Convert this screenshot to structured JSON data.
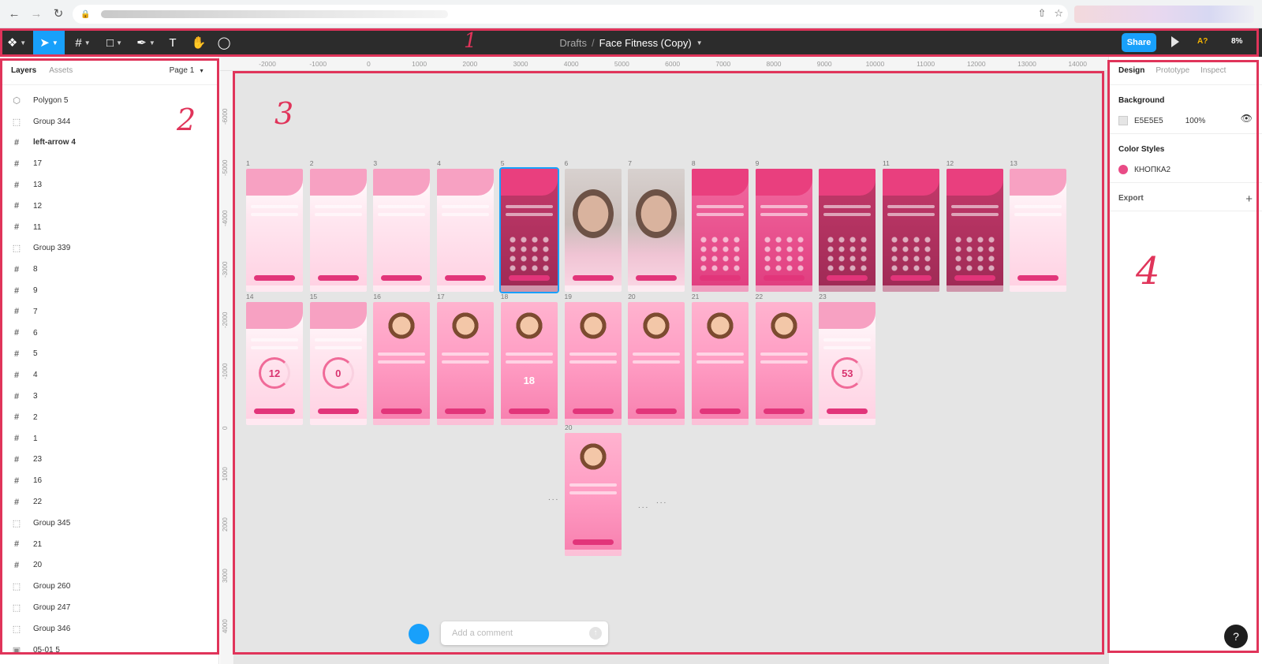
{
  "browser": {
    "back_icon": "arrow-left-icon",
    "forward_icon": "arrow-right-icon",
    "reload_icon": "reload-icon",
    "lock_icon": "lock-icon"
  },
  "toolbar": {
    "breadcrumb_root": "Drafts",
    "breadcrumb_sep": "/",
    "file_name": "Face Fitness (Copy)",
    "share_label": "Share",
    "annotation_label": "A?",
    "zoom_label": "8%"
  },
  "left_panel": {
    "tab_layers": "Layers",
    "tab_assets": "Assets",
    "page_selector": "Page 1",
    "layers": [
      {
        "name": "Polygon 5",
        "icon": "polygon-icon",
        "kind": "shape"
      },
      {
        "name": "Group 344",
        "icon": "group-icon",
        "kind": "group"
      },
      {
        "name": "left-arrow 4",
        "icon": "frame-icon",
        "kind": "frame-bold"
      },
      {
        "name": "17",
        "icon": "frame-icon",
        "kind": "frame"
      },
      {
        "name": "13",
        "icon": "frame-icon",
        "kind": "frame"
      },
      {
        "name": "12",
        "icon": "frame-icon",
        "kind": "frame"
      },
      {
        "name": "11",
        "icon": "frame-icon",
        "kind": "frame"
      },
      {
        "name": "Group 339",
        "icon": "group-icon",
        "kind": "group"
      },
      {
        "name": "8",
        "icon": "frame-icon",
        "kind": "frame"
      },
      {
        "name": "9",
        "icon": "frame-icon",
        "kind": "frame"
      },
      {
        "name": "7",
        "icon": "frame-icon",
        "kind": "frame"
      },
      {
        "name": "6",
        "icon": "frame-icon",
        "kind": "frame"
      },
      {
        "name": "5",
        "icon": "frame-icon",
        "kind": "frame"
      },
      {
        "name": "4",
        "icon": "frame-icon",
        "kind": "frame"
      },
      {
        "name": "3",
        "icon": "frame-icon",
        "kind": "frame"
      },
      {
        "name": "2",
        "icon": "frame-icon",
        "kind": "frame"
      },
      {
        "name": "1",
        "icon": "frame-icon",
        "kind": "frame"
      },
      {
        "name": "23",
        "icon": "frame-icon",
        "kind": "frame"
      },
      {
        "name": "16",
        "icon": "frame-icon",
        "kind": "frame"
      },
      {
        "name": "22",
        "icon": "frame-icon",
        "kind": "frame"
      },
      {
        "name": "Group 345",
        "icon": "group-icon",
        "kind": "group"
      },
      {
        "name": "21",
        "icon": "frame-icon",
        "kind": "frame"
      },
      {
        "name": "20",
        "icon": "frame-icon",
        "kind": "frame"
      },
      {
        "name": "Group 260",
        "icon": "group-icon",
        "kind": "group"
      },
      {
        "name": "Group 247",
        "icon": "group-icon",
        "kind": "group"
      },
      {
        "name": "Group 346",
        "icon": "group-icon",
        "kind": "group"
      },
      {
        "name": "05-01 5",
        "icon": "image-icon",
        "kind": "image"
      }
    ]
  },
  "ruler": {
    "top_ticks": [
      "-2000",
      "-1000",
      "0",
      "1000",
      "2000",
      "3000",
      "4000",
      "5000",
      "6000",
      "7000",
      "8000",
      "9000",
      "10000",
      "11000",
      "12000",
      "13000",
      "14000"
    ],
    "left_ticks": [
      "-6000",
      "-5000",
      "-4000",
      "-3000",
      "-2000",
      "-1000",
      "0",
      "1000",
      "2000",
      "3000",
      "4000"
    ]
  },
  "canvas": {
    "frames_row1": [
      {
        "num": "1",
        "style": "light"
      },
      {
        "num": "2",
        "style": "light"
      },
      {
        "num": "3",
        "style": "light"
      },
      {
        "num": "4",
        "style": "light"
      },
      {
        "num": "5",
        "style": "dark",
        "selected": true
      },
      {
        "num": "6",
        "style": "photo"
      },
      {
        "num": "7",
        "style": "photo"
      },
      {
        "num": "8",
        "style": "pink"
      },
      {
        "num": "9",
        "style": "pink"
      },
      {
        "num": "",
        "style": "dark"
      },
      {
        "num": "11",
        "style": "dark"
      },
      {
        "num": "12",
        "style": "dark"
      },
      {
        "num": "13",
        "style": "light"
      }
    ],
    "frames_row2": [
      {
        "num": "14",
        "style": "light",
        "big": "12"
      },
      {
        "num": "15",
        "style": "light",
        "big": "0"
      },
      {
        "num": "16",
        "style": "step"
      },
      {
        "num": "17",
        "style": "step"
      },
      {
        "num": "18",
        "style": "step",
        "big": "18"
      },
      {
        "num": "19",
        "style": "step"
      },
      {
        "num": "20",
        "style": "step"
      },
      {
        "num": "21",
        "style": "step"
      },
      {
        "num": "22",
        "style": "step"
      },
      {
        "num": "23",
        "style": "light",
        "big": "53"
      }
    ],
    "ellipsis": "...",
    "comment_placeholder": "Add a comment"
  },
  "right_panel": {
    "tab_design": "Design",
    "tab_prototype": "Prototype",
    "tab_inspect": "Inspect",
    "background_title": "Background",
    "background_hex": "E5E5E5",
    "background_opacity": "100%",
    "background_color": "#E5E5E5",
    "color_styles_title": "Color Styles",
    "color_style_name": "КНОПКА2",
    "color_style_color": "#E94B86",
    "export_title": "Export",
    "help_label": "?"
  },
  "annotations": {
    "n1": "1",
    "n2": "2",
    "n3": "3",
    "n4": "4",
    "color": "#E0345A"
  },
  "colors": {
    "toolbar_bg": "#2C2C2C",
    "accent": "#18A0FB",
    "brand_pink": "#E94B86"
  }
}
